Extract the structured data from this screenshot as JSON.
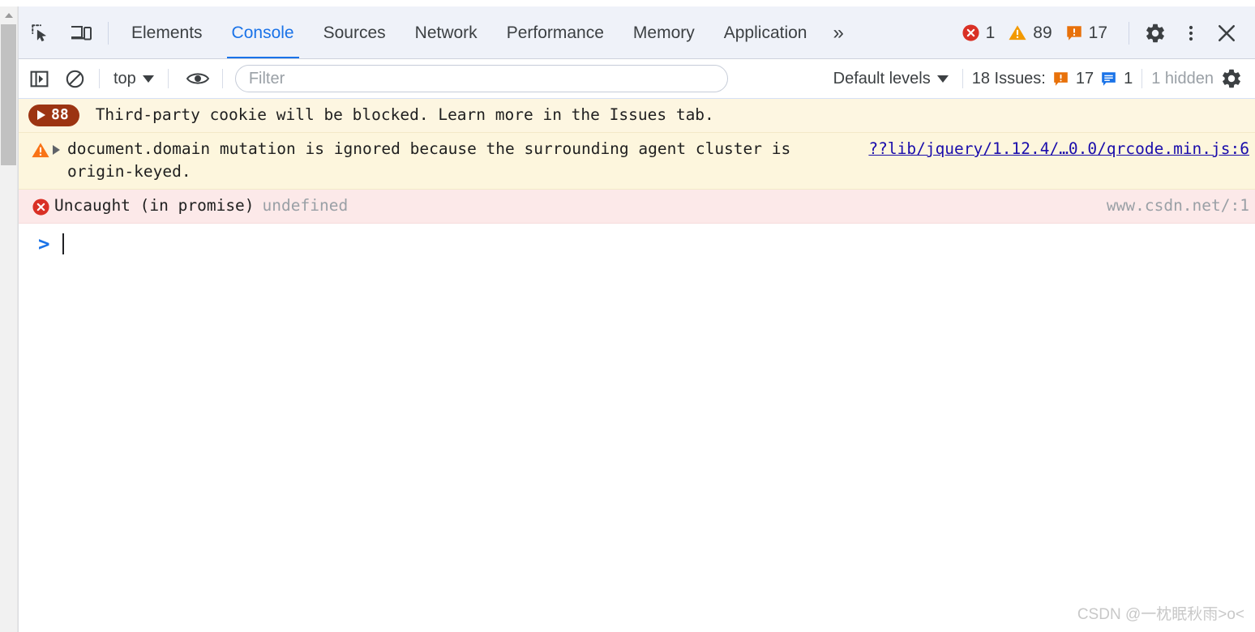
{
  "window": {
    "top_strip_color": "#ffffff"
  },
  "scrollbar": {
    "up_arrow_name": "scroll-up-arrow"
  },
  "tabbar": {
    "inspect_icon": "inspect-element-icon",
    "device_icon": "device-toolbar-icon",
    "tabs": [
      {
        "label": "Elements",
        "active": false
      },
      {
        "label": "Console",
        "active": true
      },
      {
        "label": "Sources",
        "active": false
      },
      {
        "label": "Network",
        "active": false
      },
      {
        "label": "Performance",
        "active": false
      },
      {
        "label": "Memory",
        "active": false
      },
      {
        "label": "Application",
        "active": false
      }
    ],
    "more_tabs_label": "»",
    "counts": {
      "errors": "1",
      "warnings": "89",
      "issues": "17"
    },
    "settings_icon": "gear-icon",
    "more_options_icon": "kebab-menu-icon",
    "close_icon": "close-icon",
    "accent_color": "#1a73e8",
    "background": "#eff2f9"
  },
  "console_toolbar": {
    "sidebar_icon": "console-sidebar-icon",
    "clear_icon": "clear-console-icon",
    "context_selector": "top",
    "eye_icon": "live-expression-icon",
    "filter_placeholder": "Filter",
    "filter_value": "",
    "levels_selector": "Default levels",
    "issues_prefix": "18 Issues:",
    "issues_count": "17",
    "info_count": "1",
    "hidden_label": "1 hidden",
    "settings_icon": "console-settings-gear-icon"
  },
  "messages": [
    {
      "kind": "violation",
      "badge": "88",
      "text": "Third-party cookie will be blocked. Learn more in the Issues tab.",
      "source": "",
      "source_is_link": false,
      "icon": "violation-play-badge"
    },
    {
      "kind": "warning",
      "text": "document.domain mutation is ignored because the surrounding agent cluster is origin-keyed.",
      "source": "??lib/jquery/1.12.4/…0.0/qrcode.min.js:6",
      "source_is_link": true,
      "icon": "warning-triangle-icon"
    },
    {
      "kind": "error",
      "text": "Uncaught (in promise)",
      "dim_text": "undefined",
      "source": "www.csdn.net/:1",
      "source_is_link": false,
      "icon": "error-circle-icon"
    }
  ],
  "prompt": {
    "caret": ">",
    "value": ""
  },
  "watermark": {
    "text": "CSDN @一枕眠秋雨>o<"
  }
}
